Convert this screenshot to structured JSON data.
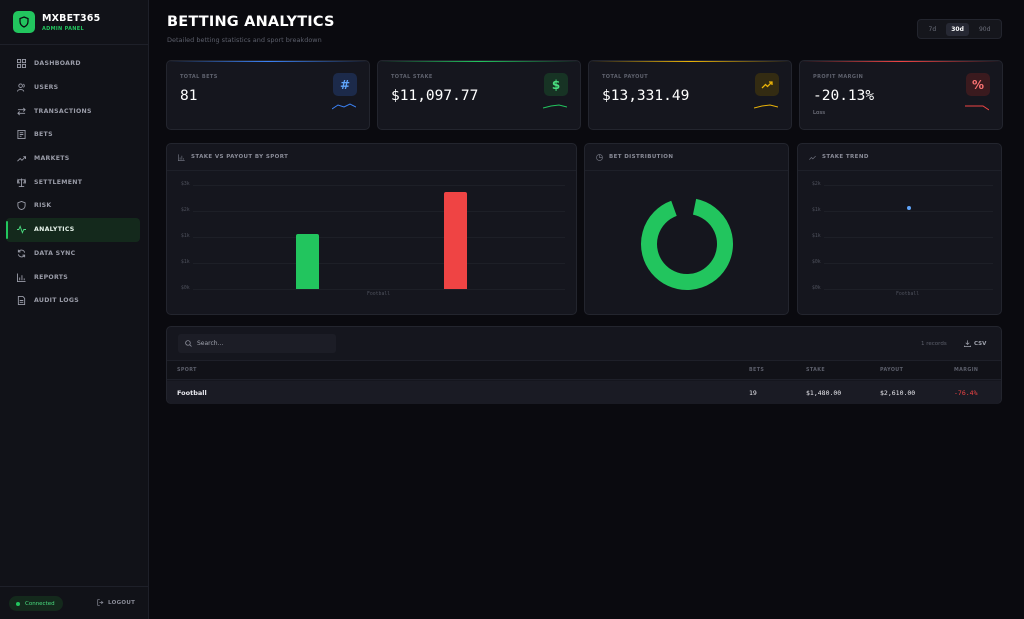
{
  "brand": {
    "name": "MXBET365",
    "sub": "ADMIN PANEL"
  },
  "nav": [
    {
      "label": "DASHBOARD",
      "icon": "grid-icon"
    },
    {
      "label": "USERS",
      "icon": "users-icon"
    },
    {
      "label": "TRANSACTIONS",
      "icon": "arrows-icon"
    },
    {
      "label": "BETS",
      "icon": "ticket-icon"
    },
    {
      "label": "MARKETS",
      "icon": "trending-up-icon"
    },
    {
      "label": "SETTLEMENT",
      "icon": "scale-icon"
    },
    {
      "label": "RISK",
      "icon": "shield-icon"
    },
    {
      "label": "ANALYTICS",
      "icon": "activity-icon",
      "active": true
    },
    {
      "label": "DATA SYNC",
      "icon": "refresh-icon"
    },
    {
      "label": "REPORTS",
      "icon": "bar-chart-icon"
    },
    {
      "label": "AUDIT LOGS",
      "icon": "file-icon"
    }
  ],
  "footer": {
    "status": "Connected",
    "logout": "LOGOUT"
  },
  "header": {
    "title": "BETTING ANALYTICS",
    "subtitle": "Detailed betting statistics and sport breakdown"
  },
  "range": {
    "options": [
      "7d",
      "30d",
      "90d"
    ],
    "selected": "30d"
  },
  "stats": [
    {
      "label": "TOTAL BETS",
      "value": "81",
      "note": "",
      "icon": "#",
      "accent": "#3b82f6"
    },
    {
      "label": "TOTAL STAKE",
      "value": "$11,097.77",
      "note": "",
      "icon": "$",
      "accent": "#22c55e"
    },
    {
      "label": "TOTAL PAYOUT",
      "value": "$13,331.49",
      "note": "",
      "icon": "trending-up-icon",
      "accent": "#eab308"
    },
    {
      "label": "PROFIT MARGIN",
      "value": "-20.13%",
      "note": "Loss",
      "icon": "%",
      "accent": "#ef4444"
    }
  ],
  "panels": {
    "stake_vs_payout": "STAKE VS PAYOUT BY SPORT",
    "distribution": "BET DISTRIBUTION",
    "trend": "STAKE TREND"
  },
  "chart_data": [
    {
      "type": "bar",
      "title": "STAKE VS PAYOUT BY SPORT",
      "categories": [
        "Football"
      ],
      "series": [
        {
          "values": [
            1480
          ],
          "color": "#22c55e"
        },
        {
          "values": [
            2610
          ],
          "color": "#ef4444"
        }
      ],
      "yticks": [
        "$0k",
        "$1k",
        "$1k",
        "$2k",
        "$3k"
      ],
      "ylim": [
        0,
        2800
      ]
    },
    {
      "type": "pie",
      "title": "BET DISTRIBUTION",
      "slices": [
        {
          "label": "Football",
          "value": 100,
          "color": "#22c55e"
        }
      ]
    },
    {
      "type": "scatter",
      "title": "STAKE TREND",
      "x": [
        "Football"
      ],
      "yticks": [
        "$0k",
        "$0k",
        "$1k",
        "$1k",
        "$2k"
      ],
      "points": [
        {
          "y": 1.55
        }
      ],
      "ylim": [
        0,
        2
      ]
    }
  ],
  "table": {
    "search_placeholder": "Search...",
    "records": "1 records",
    "csv": "CSV",
    "columns": [
      "SPORT",
      "BETS",
      "STAKE",
      "PAYOUT",
      "MARGIN"
    ],
    "rows": [
      [
        "Football",
        "19",
        "$1,480.00",
        "$2,610.00",
        "-76.4%"
      ]
    ]
  },
  "colors": {
    "accent": "#22c55e",
    "negative": "#ef4444",
    "bg": "#0a0a0f"
  }
}
